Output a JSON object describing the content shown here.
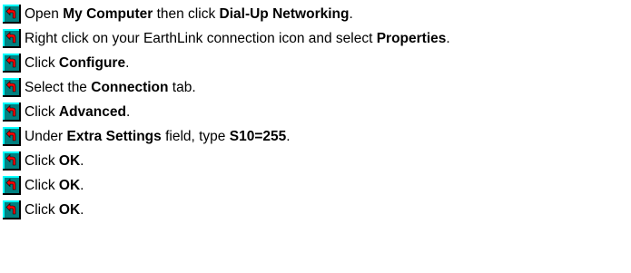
{
  "steps": [
    {
      "icon": "jump-arrow-icon",
      "parts": [
        "Open ",
        "My Computer",
        " then click ",
        "Dial-Up Networking",
        "."
      ]
    },
    {
      "icon": "jump-arrow-icon",
      "parts": [
        "Right click on your EarthLink connection icon and select ",
        "Properties",
        "."
      ]
    },
    {
      "icon": "jump-arrow-icon",
      "parts": [
        "Click ",
        "Configure",
        "."
      ]
    },
    {
      "icon": "jump-arrow-icon",
      "parts": [
        "Select the ",
        "Connection",
        " tab."
      ]
    },
    {
      "icon": "jump-arrow-icon",
      "parts": [
        "Click ",
        "Advanced",
        "."
      ]
    },
    {
      "icon": "jump-arrow-icon",
      "parts": [
        "Under ",
        "Extra Settings",
        " field, type ",
        "S10=255",
        "."
      ]
    },
    {
      "icon": "jump-arrow-icon",
      "parts": [
        "Click ",
        "OK",
        "."
      ]
    },
    {
      "icon": "jump-arrow-icon",
      "parts": [
        "Click ",
        "OK",
        "."
      ]
    },
    {
      "icon": "jump-arrow-icon",
      "parts": [
        "Click ",
        "OK",
        "."
      ]
    }
  ],
  "colors": {
    "icon_face": "#008080",
    "icon_arrow": "#ff0000",
    "icon_highlight": "#00ffff",
    "icon_shadow": "#000000",
    "text": "#000000",
    "background": "#ffffff"
  }
}
